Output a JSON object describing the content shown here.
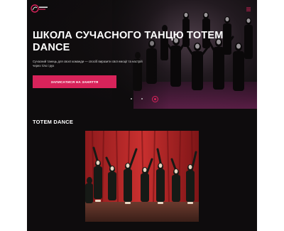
{
  "header": {
    "logo_text": "TOTEM DANCE",
    "menu_icon": "menu-icon"
  },
  "hero": {
    "title": "ШКОЛА СУЧАСНОГО ТАНЦЮ TOTEM DANCE",
    "subtitle": "Сучасний танець для своєї команди — спосіб виразити свої емоції та настрій через тіло і рух",
    "cta_label": "ЗАПИСАТИСЯ НА ЗАНЯТТЯ",
    "slider": {
      "count": 3,
      "active_index": 2
    }
  },
  "about": {
    "title": "TOTEM DANCE"
  },
  "colors": {
    "accent": "#d8235a",
    "background": "#0e0c0d",
    "text": "#ffffff"
  }
}
